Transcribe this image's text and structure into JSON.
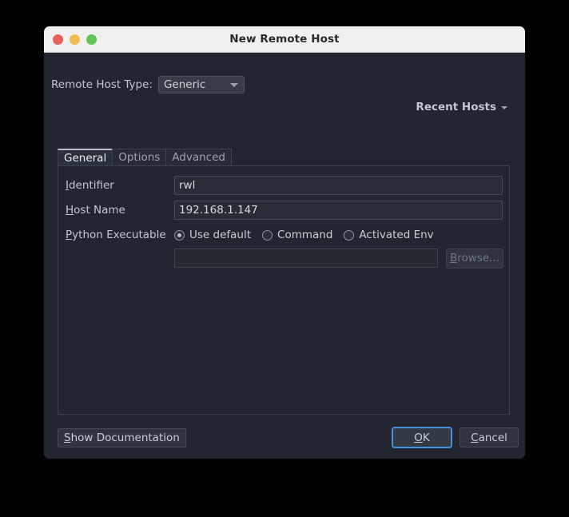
{
  "window": {
    "title": "New Remote Host",
    "traffic_lights": [
      {
        "name": "close",
        "color": "#e8605a"
      },
      {
        "name": "minimize",
        "color": "#f2bd4e"
      },
      {
        "name": "maximize",
        "color": "#62c457"
      }
    ]
  },
  "host_type": {
    "label": "Remote Host Type:",
    "value": "Generic",
    "options": [
      "Generic"
    ]
  },
  "recent_hosts": {
    "label": "Recent Hosts",
    "icon": "chevron-down-icon"
  },
  "tabs": [
    {
      "label": "General",
      "active": true
    },
    {
      "label": "Options",
      "active": false
    },
    {
      "label": "Advanced",
      "active": false
    }
  ],
  "form": {
    "identifier": {
      "label_pre": "",
      "label_mnemonic": "I",
      "label_post": "dentifier",
      "value": "rwl",
      "placeholder": ""
    },
    "host_name": {
      "label_pre": "",
      "label_mnemonic": "H",
      "label_post": "ost Name",
      "value": "192.168.1.147",
      "placeholder": ""
    },
    "python_executable": {
      "label_pre": "",
      "label_mnemonic": "P",
      "label_post": "ython Executable",
      "options": [
        {
          "label": "Use default",
          "checked": true
        },
        {
          "label": "Command",
          "checked": false
        },
        {
          "label": "Activated Env",
          "checked": false
        }
      ],
      "path_value": "",
      "path_placeholder": "",
      "browse_label_mnemonic": "B",
      "browse_label_post": "rowse..."
    }
  },
  "footer": {
    "show_documentation": {
      "mnemonic": "S",
      "post": "how Documentation"
    },
    "ok": {
      "mnemonic": "O",
      "post": "K"
    },
    "cancel": {
      "mnemonic": "C",
      "post": "ancel"
    }
  },
  "colors": {
    "window_bg": "#222630",
    "titlebar_bg": "#f0f0ef",
    "accent_focus": "#4a90d9",
    "text_primary": "#c9cdd6",
    "panel_border": "#3b414d"
  }
}
